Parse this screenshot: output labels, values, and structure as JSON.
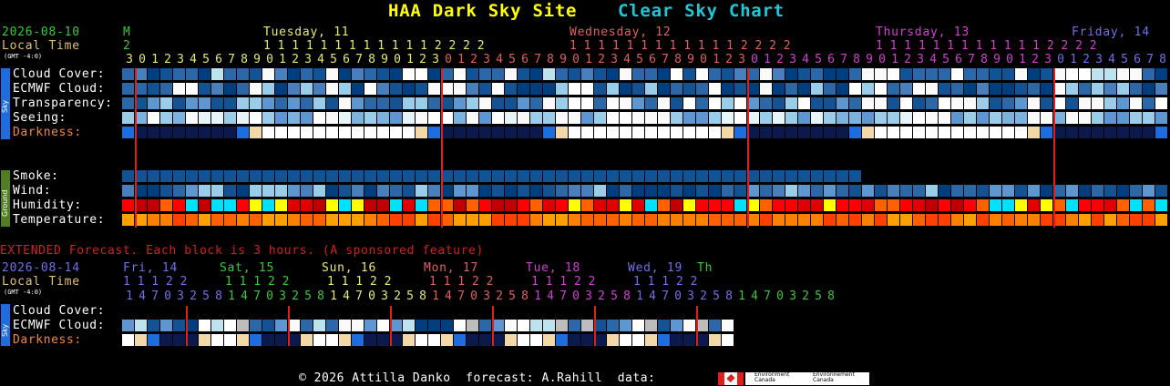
{
  "header": {
    "site": "HAA Dark Sky Site",
    "chart": "Clear Sky Chart",
    "date": "2026-08-10",
    "local_time": "Local Time",
    "gmt": "(GMT -4:0)"
  },
  "days": {
    "m": "M",
    "m_hour": "2",
    "tue": "Tuesday, 11",
    "wed": "Wednesday, 12",
    "thu": "Thursday, 13",
    "fri": "Friday, 14"
  },
  "hours": {
    "row_tens_tue": "1 1 1 1 1 1 1 1 1 1 1 1 2 2 2 2",
    "row_tens_wed": "1 1 1 1 1 1 1 1 1 1 1 1 2 2 2 2",
    "row_tens_thu": "1 1 1 1 1 1 1 1 1 1 1 1 2 2 2 2",
    "units": "3012345678901234567890123012345678901234567890123012345678901234567890123012345678"
  },
  "sky_labels": [
    "Cloud Cover:",
    "ECMWF Cloud:",
    "Transparency:",
    "Seeing:",
    "Darkness:"
  ],
  "ground_labels": [
    "Smoke:",
    "Wind:",
    "Humidity:",
    "Temperature:"
  ],
  "sidebar": {
    "sky": "Sky",
    "ground": "Ground"
  },
  "extended": {
    "notice": "EXTENDED Forecast. Each block is 3 hours. (A sponsored feature)",
    "date": "2026-08-14",
    "local_time": "Local Time",
    "gmt": "(GMT -4:0)",
    "days": [
      "Fri, 14",
      "Sat, 15",
      "Sun, 16",
      "Mon, 17",
      "Tue, 18",
      "Wed, 19",
      "Th"
    ],
    "tens": "1 1 1 2 2",
    "units": "14703258147032581470325814703258147032581470325814703258",
    "labels": [
      "Cloud Cover:",
      "ECMWF Cloud:",
      "Darkness:"
    ],
    "sky": "Sky"
  },
  "footer": {
    "copyright": "© 2026 Attilla Danko  forecast: A.Rahill  data:",
    "env1": "Environment Canada",
    "env2": "Environnement Canada"
  },
  "colors": {
    "cloud": [
      "#003f7f",
      "#135394",
      "#2c67a8",
      "#4a7fbd",
      "#5d96d0",
      "#7bb3de",
      "#99cde9",
      "#bde3ee",
      "#e6f5f8",
      "#fafafa",
      "#ffffff"
    ],
    "dark": "#0b1a4a",
    "twilight_blue": "#1d6ce0",
    "twilight_sand": "#f4d9a8",
    "red_line": "#e0201a",
    "humidity": [
      "#ff0000",
      "#e00000",
      "#c00000",
      "#ff6000",
      "#00e0ff",
      "#ffff00"
    ],
    "temperature": [
      "#ff8000",
      "#ff6000",
      "#ff4000",
      "#ffa000"
    ]
  }
}
